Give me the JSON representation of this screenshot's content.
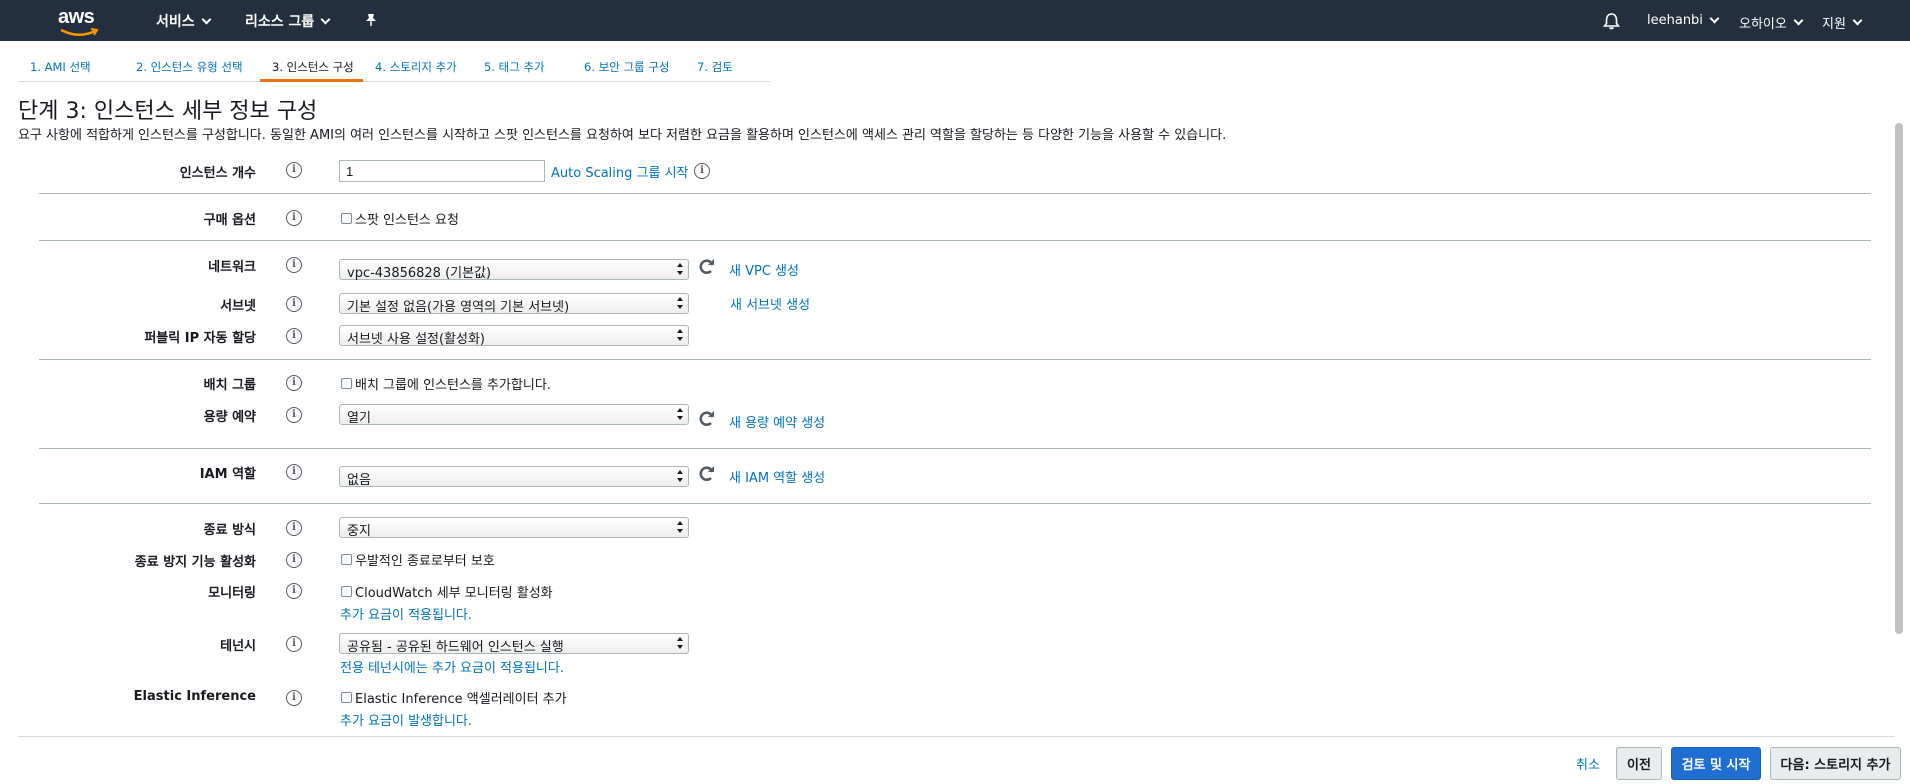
{
  "topnav": {
    "logo": "aws",
    "services": "서비스",
    "resource_groups": "리소스 그룹",
    "user": "leehanbi",
    "region": "오하이오",
    "support": "지원"
  },
  "steps": [
    {
      "label": "1. AMI 선택"
    },
    {
      "label": "2. 인스턴스 유형 선택"
    },
    {
      "label": "3. 인스턴스 구성"
    },
    {
      "label": "4. 스토리지 추가"
    },
    {
      "label": "5. 태그 추가"
    },
    {
      "label": "6. 보안 그룹 구성"
    },
    {
      "label": "7. 검토"
    }
  ],
  "page": {
    "title": "단계 3: 인스턴스 세부 정보 구성",
    "description": "요구 사항에 적합하게 인스턴스를 구성합니다. 동일한 AMI의 여러 인스턴스를 시작하고 스팟 인스턴스를 요청하여 보다 저렴한 요금을 활용하며 인스턴스에 액세스 관리 역할을 할당하는 등 다양한 기능을 사용할 수 있습니다."
  },
  "form": {
    "instance_count": {
      "label": "인스턴스 개수",
      "value": "1",
      "link": "Auto Scaling 그룹 시작"
    },
    "purchase_option": {
      "label": "구매 옵션",
      "checkbox": "스팟 인스턴스 요청"
    },
    "network": {
      "label": "네트워크",
      "value": "vpc-43856828 (기본값)",
      "link": "새 VPC 생성"
    },
    "subnet": {
      "label": "서브넷",
      "value": "기본 설정 없음(가용 영역의 기본 서브넷)",
      "link": "새 서브넷 생성"
    },
    "public_ip": {
      "label": "퍼블릭 IP 자동 할당",
      "value": "서브넷 사용 설정(활성화)"
    },
    "placement_group": {
      "label": "배치 그룹",
      "checkbox": "배치 그룹에 인스턴스를 추가합니다."
    },
    "capacity_reservation": {
      "label": "용량 예약",
      "value": "열기",
      "link": "새 용량 예약 생성"
    },
    "iam_role": {
      "label": "IAM 역할",
      "value": "없음",
      "link": "새 IAM 역할 생성"
    },
    "shutdown_behavior": {
      "label": "종료 방식",
      "value": "중지"
    },
    "termination_protection": {
      "label": "종료 방지 기능 활성화",
      "checkbox": "우발적인 종료로부터 보호"
    },
    "monitoring": {
      "label": "모니터링",
      "checkbox": "CloudWatch 세부 모니터링 활성화",
      "note": "추가 요금이 적용됩니다."
    },
    "tenancy": {
      "label": "테넌시",
      "value": "공유됨 - 공유된 하드웨어 인스턴스 실행",
      "note": "전용 테넌시에는 추가 요금이 적용됩니다."
    },
    "elastic_inference": {
      "label": "Elastic Inference",
      "checkbox": "Elastic Inference 액셀러레이터 추가",
      "note": "추가 요금이 발생합니다."
    }
  },
  "footer": {
    "cancel": "취소",
    "previous": "이전",
    "review_launch": "검토 및 시작",
    "next": "다음: 스토리지 추가"
  },
  "colors": {
    "nav_bg": "#232f3e",
    "link": "#0073bb",
    "active_tab": "#ec7211",
    "primary_button": "#1e6fd1"
  }
}
